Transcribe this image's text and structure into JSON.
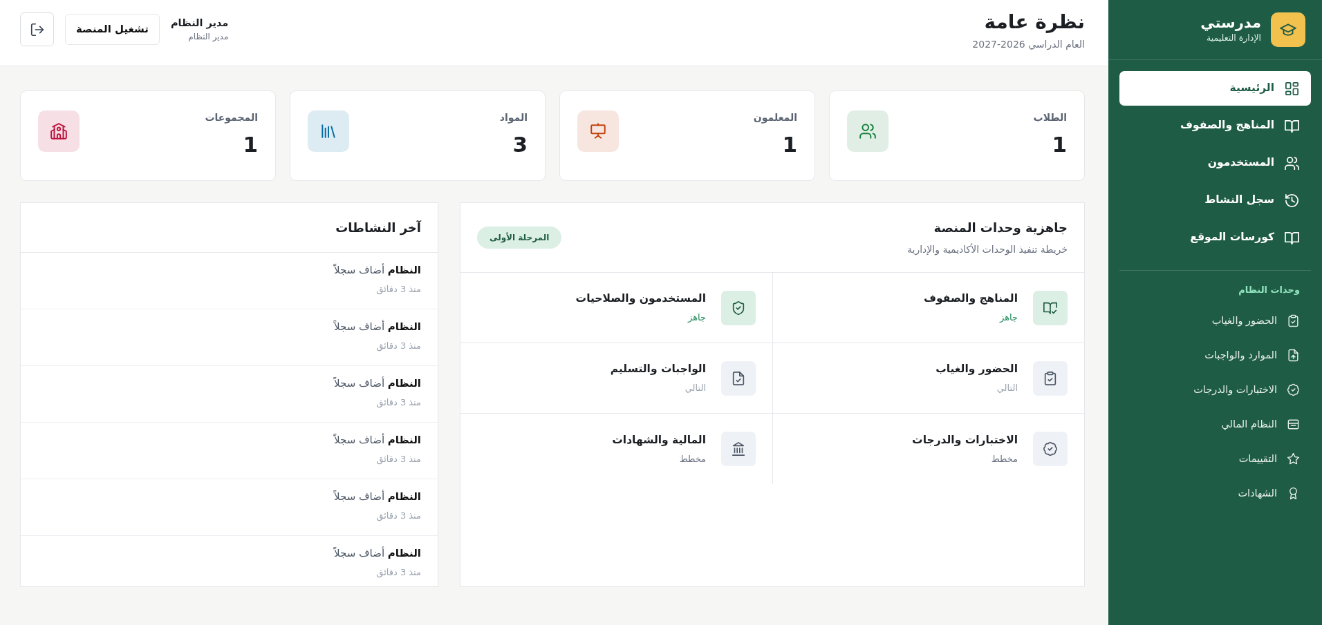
{
  "sidebar": {
    "brand": {
      "name": "مدرستي",
      "tagline": "الإدارة التعليمية"
    },
    "nav": [
      {
        "label": "الرئيسية",
        "selected": true
      },
      {
        "label": "المناهج والصفوف",
        "selected": false
      },
      {
        "label": "المستخدمون",
        "selected": false
      },
      {
        "label": "سجل النشاط",
        "selected": false
      },
      {
        "label": "كورسات الموقع",
        "selected": false
      }
    ],
    "section_title": "وحدات النظام",
    "modules": [
      {
        "label": "الحضور والغياب"
      },
      {
        "label": "الموارد والواجبات"
      },
      {
        "label": "الاختبارات والدرجات"
      },
      {
        "label": "النظام المالي"
      },
      {
        "label": "التقييمات"
      },
      {
        "label": "الشهادات"
      }
    ]
  },
  "header": {
    "title": "نظرة عامة",
    "subtitle": "العام الدراسي 2026-2027",
    "user_name": "مدير النظام",
    "user_role": "مدير النظام",
    "action_button": "تشغيل المنصة"
  },
  "stats": [
    {
      "label": "الطلاب",
      "value": "1",
      "color": "#15803d"
    },
    {
      "label": "المعلمون",
      "value": "1",
      "color": "#c2410c"
    },
    {
      "label": "المواد",
      "value": "3",
      "color": "#0369a1"
    },
    {
      "label": "المجموعات",
      "value": "1",
      "color": "#be123c"
    }
  ],
  "readiness": {
    "title": "جاهزية وحدات المنصة",
    "subtitle": "خريطة تنفيذ الوحدات الأكاديمية والإدارية",
    "badge": "المرحلة الأولى",
    "modules": [
      {
        "name": "المناهج والصفوف",
        "status": "جاهز",
        "kind": "ready"
      },
      {
        "name": "المستخدمون والصلاحيات",
        "status": "جاهز",
        "kind": "ready"
      },
      {
        "name": "الحضور والغياب",
        "status": "التالي",
        "kind": "next"
      },
      {
        "name": "الواجبات والتسليم",
        "status": "التالي",
        "kind": "next"
      },
      {
        "name": "الاختبارات والدرجات",
        "status": "مخطط",
        "kind": "planned"
      },
      {
        "name": "المالية والشهادات",
        "status": "مخطط",
        "kind": "planned"
      }
    ]
  },
  "activity": {
    "title": "آخر النشاطات",
    "items": [
      {
        "text": "**النظام** أضاف سجلاً",
        "time": "منذ 3 دقائق"
      },
      {
        "text": "**النظام** أضاف سجلاً",
        "time": "منذ 3 دقائق"
      },
      {
        "text": "**النظام** أضاف سجلاً",
        "time": "منذ 3 دقائق"
      },
      {
        "text": "**النظام** أضاف سجلاً",
        "time": "منذ 3 دقائق"
      },
      {
        "text": "**النظام** أضاف سجلاً",
        "time": "منذ 3 دقائق"
      },
      {
        "text": "**النظام** أضاف سجلاً",
        "time": "منذ 3 دقائق"
      }
    ]
  }
}
